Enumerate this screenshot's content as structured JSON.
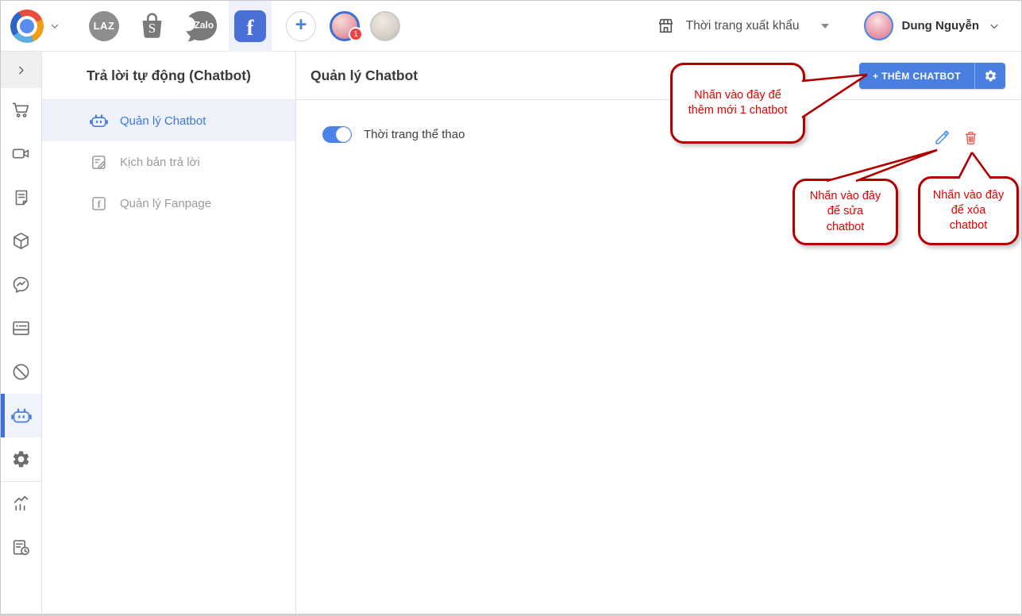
{
  "topbar": {
    "channels": {
      "laz": "LAZ",
      "shopee": "S",
      "zalo": "Zalo",
      "facebook": "f",
      "add": "+"
    },
    "notification_count": "1",
    "store_name": "Thời trang xuất khẩu",
    "user_name": "Dung Nguyễn"
  },
  "rail": {
    "icons": [
      "expand",
      "cart",
      "livestream",
      "orders",
      "products",
      "messenger",
      "pos-card",
      "blocked",
      "chatbot",
      "settings",
      "analytics",
      "reports"
    ],
    "active": "chatbot"
  },
  "sidebar": {
    "title": "Trả lời tự động (Chatbot)",
    "items": [
      {
        "label": "Quản lý Chatbot",
        "active": true
      },
      {
        "label": "Kịch bản trả lời",
        "active": false
      },
      {
        "label": "Quản lý Fanpage",
        "active": false
      }
    ]
  },
  "main": {
    "title": "Quản lý Chatbot",
    "add_button_label": "+ THÊM CHATBOT",
    "chatbots": [
      {
        "name": "Thời trang thể thao",
        "enabled": true
      }
    ]
  },
  "annotations": {
    "add_chatbot": {
      "line1": "Nhấn vào đây để",
      "line2": "thêm mới 1 chatbot"
    },
    "edit_chatbot": {
      "line1": "Nhấn vào đây",
      "line2": "để sửa",
      "line3": "chatbot"
    },
    "delete_chatbot": {
      "line1": "Nhấn vào đây",
      "line2": "để xóa",
      "line3": "chatbot"
    }
  },
  "colors": {
    "accent_blue": "#497fe0",
    "facebook_blue": "#4a6fd6",
    "toggle_blue": "#4a82e8",
    "annotation_border": "#b20000",
    "annotation_text": "#e60000",
    "edit_icon_blue": "#4285f4",
    "delete_icon_red": "#e9544d",
    "badge_red": "#f23f3f"
  }
}
